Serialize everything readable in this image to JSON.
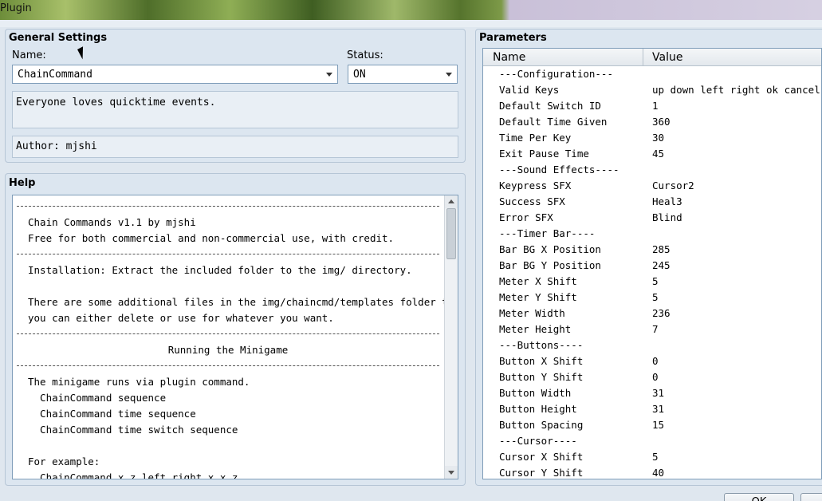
{
  "window": {
    "title": "Plugin"
  },
  "general": {
    "title": "General Settings",
    "name_label": "Name:",
    "name_value": "ChainCommand",
    "status_label": "Status:",
    "status_value": "ON",
    "description": "Everyone loves quicktime events.",
    "author": "Author: mjshi"
  },
  "help": {
    "title": "Help",
    "lines": [
      {
        "text": "",
        "type": "sep"
      },
      {
        "text": "Chain Commands v1.1 by mjshi",
        "type": "text"
      },
      {
        "text": "Free for both commercial and non-commercial use, with credit.",
        "type": "text"
      },
      {
        "text": "",
        "type": "sep"
      },
      {
        "text": "Installation: Extract the included folder to the img/ directory.",
        "type": "text"
      },
      {
        "text": "",
        "type": "text"
      },
      {
        "text": "There are some additional files in the img/chaincmd/templates folder that",
        "type": "text"
      },
      {
        "text": "you can either delete or use for whatever you want.",
        "type": "text"
      },
      {
        "text": "",
        "type": "sep"
      },
      {
        "text": "Running the Minigame",
        "type": "center"
      },
      {
        "text": "",
        "type": "sep"
      },
      {
        "text": "The minigame runs via plugin command.",
        "type": "text"
      },
      {
        "text": "  ChainCommand sequence",
        "type": "text"
      },
      {
        "text": "  ChainCommand time sequence",
        "type": "text"
      },
      {
        "text": "  ChainCommand time switch sequence",
        "type": "text"
      },
      {
        "text": "",
        "type": "text"
      },
      {
        "text": "For example:",
        "type": "text"
      },
      {
        "text": "  ChainCommand x z left right x x z",
        "type": "text"
      }
    ]
  },
  "parameters": {
    "title": "Parameters",
    "col_name": "Name",
    "col_value": "Value",
    "rows": [
      {
        "name": "---Configuration---",
        "value": ""
      },
      {
        "name": "Valid Keys",
        "value": "up down left right ok cancel"
      },
      {
        "name": "Default Switch ID",
        "value": "1"
      },
      {
        "name": "Default Time Given",
        "value": "360"
      },
      {
        "name": "Time Per Key",
        "value": "30"
      },
      {
        "name": "Exit Pause Time",
        "value": "45"
      },
      {
        "name": "---Sound Effects----",
        "value": ""
      },
      {
        "name": "Keypress SFX",
        "value": "Cursor2"
      },
      {
        "name": "Success SFX",
        "value": "Heal3"
      },
      {
        "name": "Error SFX",
        "value": "Blind"
      },
      {
        "name": "---Timer Bar----",
        "value": ""
      },
      {
        "name": "Bar BG X Position",
        "value": "285"
      },
      {
        "name": "Bar BG Y Position",
        "value": "245"
      },
      {
        "name": "Meter X Shift",
        "value": "5"
      },
      {
        "name": "Meter Y Shift",
        "value": "5"
      },
      {
        "name": "Meter Width",
        "value": "236"
      },
      {
        "name": "Meter Height",
        "value": "7"
      },
      {
        "name": "---Buttons----",
        "value": ""
      },
      {
        "name": "Button X Shift",
        "value": "0"
      },
      {
        "name": "Button Y Shift",
        "value": "0"
      },
      {
        "name": "Button Width",
        "value": "31"
      },
      {
        "name": "Button Height",
        "value": "31"
      },
      {
        "name": "Button Spacing",
        "value": "15"
      },
      {
        "name": "---Cursor----",
        "value": ""
      },
      {
        "name": "Cursor X Shift",
        "value": "5"
      },
      {
        "name": "Cursor Y Shift",
        "value": "40"
      }
    ]
  },
  "footer": {
    "ok_label": "OK"
  },
  "colors": {
    "panel_bg": "#dce6f0",
    "field_border": "#7f9db9",
    "window_bg": "#dfe7ef"
  }
}
